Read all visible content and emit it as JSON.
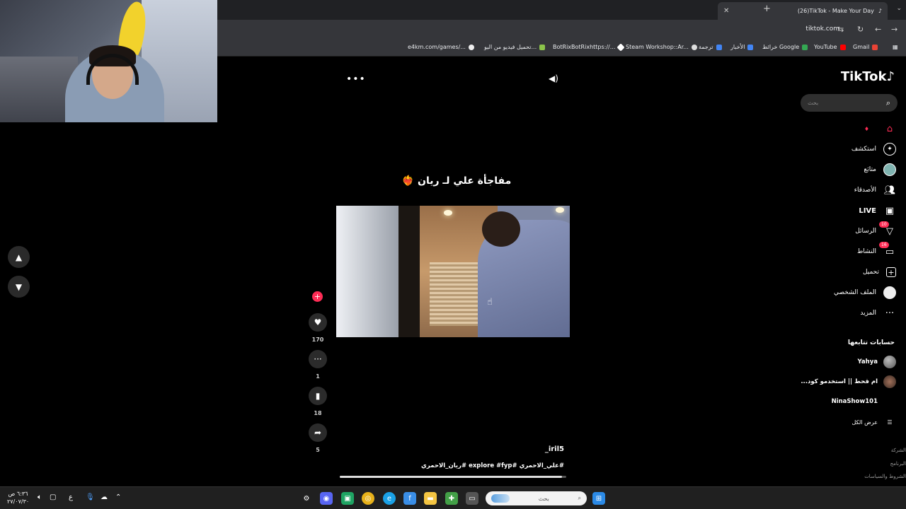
{
  "browser": {
    "tab_title": "(26)TikTok - Make Your Day",
    "url": "tiktok.com",
    "bookmarks": [
      "Gmail",
      "YouTube",
      "خرائط Google",
      "الأخبار",
      "ترجمة",
      "Steam Workshop::Ar...",
      "BotRixBotRixhttps://...",
      "تحميل فيديو من اليو...",
      "e4km.com/games/..."
    ]
  },
  "tiktok": {
    "logo": "TikTok",
    "search_placeholder": "بحث",
    "nav": [
      {
        "label": "",
        "icon": "home-icon"
      },
      {
        "label": "استكشف",
        "icon": "compass-icon"
      },
      {
        "label": "متابَع",
        "icon": "following-avatar-icon"
      },
      {
        "label": "الأصدقاء",
        "icon": "friends-icon"
      },
      {
        "label": "LIVE",
        "icon": "live-icon"
      },
      {
        "label": "الرسائل",
        "icon": "messages-icon",
        "badge": "10"
      },
      {
        "label": "النشاط",
        "icon": "activity-icon",
        "badge": "16"
      },
      {
        "label": "تحميل",
        "icon": "upload-icon"
      },
      {
        "label": "الملف الشخصي",
        "icon": "profile-icon"
      },
      {
        "label": "المزيد",
        "icon": "more-icon"
      }
    ],
    "following_title": "حسابات تتابعها",
    "following": [
      "Yahya",
      "ام قحط || استخدمو كود...",
      "NinaShow101"
    ],
    "see_all": "عرض الكل",
    "footer": [
      "الشركة",
      "البرنامج",
      "الشروط والسياسات"
    ]
  },
  "video": {
    "caption": "مفاجأة علي لـ ريان ❤️‍🔥",
    "author": "_iril5",
    "hashtags": "#علي_الاحمري #explore #fyp #ريان_الاحمري",
    "likes": "170",
    "comments": "1",
    "saves": "18",
    "shares": "5",
    "progress": 0.98
  },
  "taskbar": {
    "search_placeholder": "بحث",
    "time": "٦:٣٦ ص",
    "date": "٢٧/٠٧/٣٠",
    "lang": "ع"
  }
}
